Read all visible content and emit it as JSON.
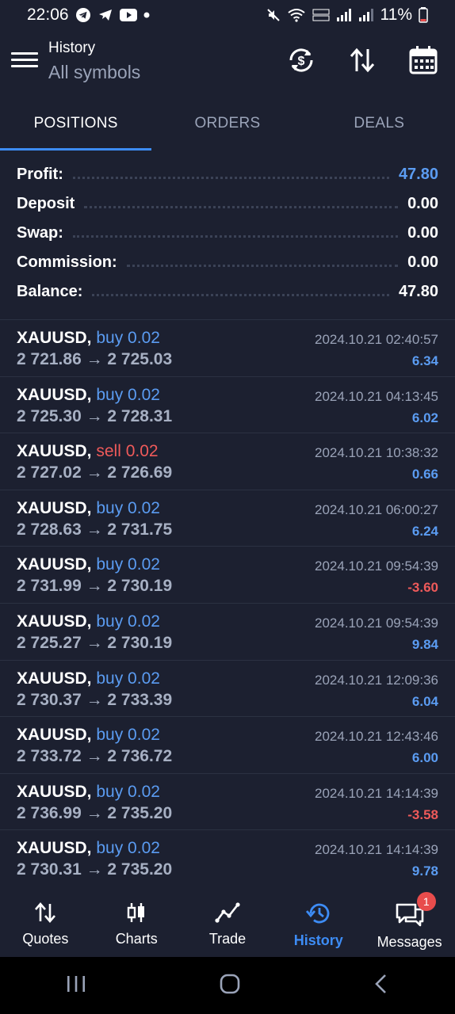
{
  "status_bar": {
    "time": "22:06",
    "battery": "11%"
  },
  "header": {
    "title": "History",
    "subtitle": "All symbols"
  },
  "tabs": [
    {
      "label": "POSITIONS",
      "active": true
    },
    {
      "label": "ORDERS",
      "active": false
    },
    {
      "label": "DEALS",
      "active": false
    }
  ],
  "summary": [
    {
      "label": "Profit:",
      "value": "47.80"
    },
    {
      "label": "Deposit",
      "value": "0.00"
    },
    {
      "label": "Swap:",
      "value": "0.00"
    },
    {
      "label": "Commission:",
      "value": "0.00"
    },
    {
      "label": "Balance:",
      "value": "47.80"
    }
  ],
  "trades": [
    {
      "symbol": "XAUUSD,",
      "side": "buy",
      "side_text": "buy 0.02",
      "prices": "2 721.86 → 2 725.03",
      "time": "2024.10.21 02:40:57",
      "profit": "6.34"
    },
    {
      "symbol": "XAUUSD,",
      "side": "buy",
      "side_text": "buy 0.02",
      "prices": "2 725.30 → 2 728.31",
      "time": "2024.10.21 04:13:45",
      "profit": "6.02"
    },
    {
      "symbol": "XAUUSD,",
      "side": "sell",
      "side_text": "sell 0.02",
      "prices": "2 727.02 → 2 726.69",
      "time": "2024.10.21 10:38:32",
      "profit": "0.66"
    },
    {
      "symbol": "XAUUSD,",
      "side": "buy",
      "side_text": "buy 0.02",
      "prices": "2 728.63 → 2 731.75",
      "time": "2024.10.21 06:00:27",
      "profit": "6.24"
    },
    {
      "symbol": "XAUUSD,",
      "side": "buy",
      "side_text": "buy 0.02",
      "prices": "2 731.99 → 2 730.19",
      "time": "2024.10.21 09:54:39",
      "profit": "-3.60"
    },
    {
      "symbol": "XAUUSD,",
      "side": "buy",
      "side_text": "buy 0.02",
      "prices": "2 725.27 → 2 730.19",
      "time": "2024.10.21 09:54:39",
      "profit": "9.84"
    },
    {
      "symbol": "XAUUSD,",
      "side": "buy",
      "side_text": "buy 0.02",
      "prices": "2 730.37 → 2 733.39",
      "time": "2024.10.21 12:09:36",
      "profit": "6.04"
    },
    {
      "symbol": "XAUUSD,",
      "side": "buy",
      "side_text": "buy 0.02",
      "prices": "2 733.72 → 2 736.72",
      "time": "2024.10.21 12:43:46",
      "profit": "6.00"
    },
    {
      "symbol": "XAUUSD,",
      "side": "buy",
      "side_text": "buy 0.02",
      "prices": "2 736.99 → 2 735.20",
      "time": "2024.10.21 14:14:39",
      "profit": "-3.58"
    },
    {
      "symbol": "XAUUSD,",
      "side": "buy",
      "side_text": "buy 0.02",
      "prices": "2 730.31 → 2 735.20",
      "time": "2024.10.21 14:14:39",
      "profit": "9.78"
    }
  ],
  "bottom_nav": [
    {
      "label": "Quotes",
      "icon": "quotes-icon",
      "active": false
    },
    {
      "label": "Charts",
      "icon": "charts-icon",
      "active": false
    },
    {
      "label": "Trade",
      "icon": "trade-icon",
      "active": false
    },
    {
      "label": "History",
      "icon": "history-icon",
      "active": true
    },
    {
      "label": "Messages",
      "icon": "messages-icon",
      "active": false,
      "badge": "1"
    }
  ],
  "colors": {
    "background": "#1c2030",
    "accent": "#3d8cf5",
    "positive": "#5b9cf2",
    "negative": "#ef5a5a",
    "muted": "#9aa3b8"
  }
}
